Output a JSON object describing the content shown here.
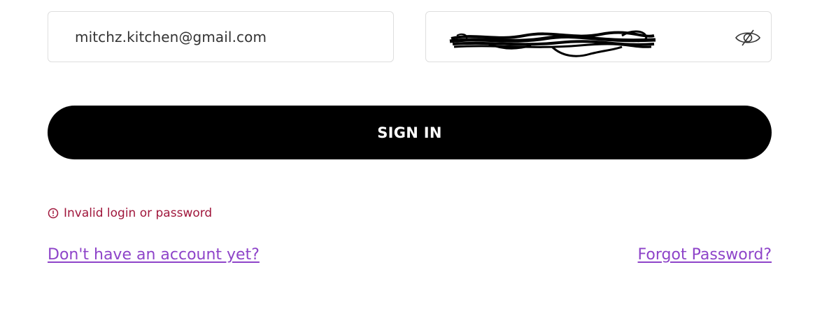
{
  "login_form": {
    "email_value": "mitchz.kitchen@gmail.com",
    "password_state": "redacted-scribble",
    "signin_label": "SIGN IN",
    "error_message": "Invalid login or password",
    "signup_link": "Don't have an account yet?",
    "forgot_link": "Forgot Password?"
  },
  "icons": {
    "password_toggle": "eye-slash-icon",
    "error": "alert-circle-icon"
  },
  "colors": {
    "button_bg": "#000000",
    "button_text": "#ffffff",
    "error": "#a0173c",
    "link": "#8e44c9",
    "field_border": "#dedede"
  }
}
